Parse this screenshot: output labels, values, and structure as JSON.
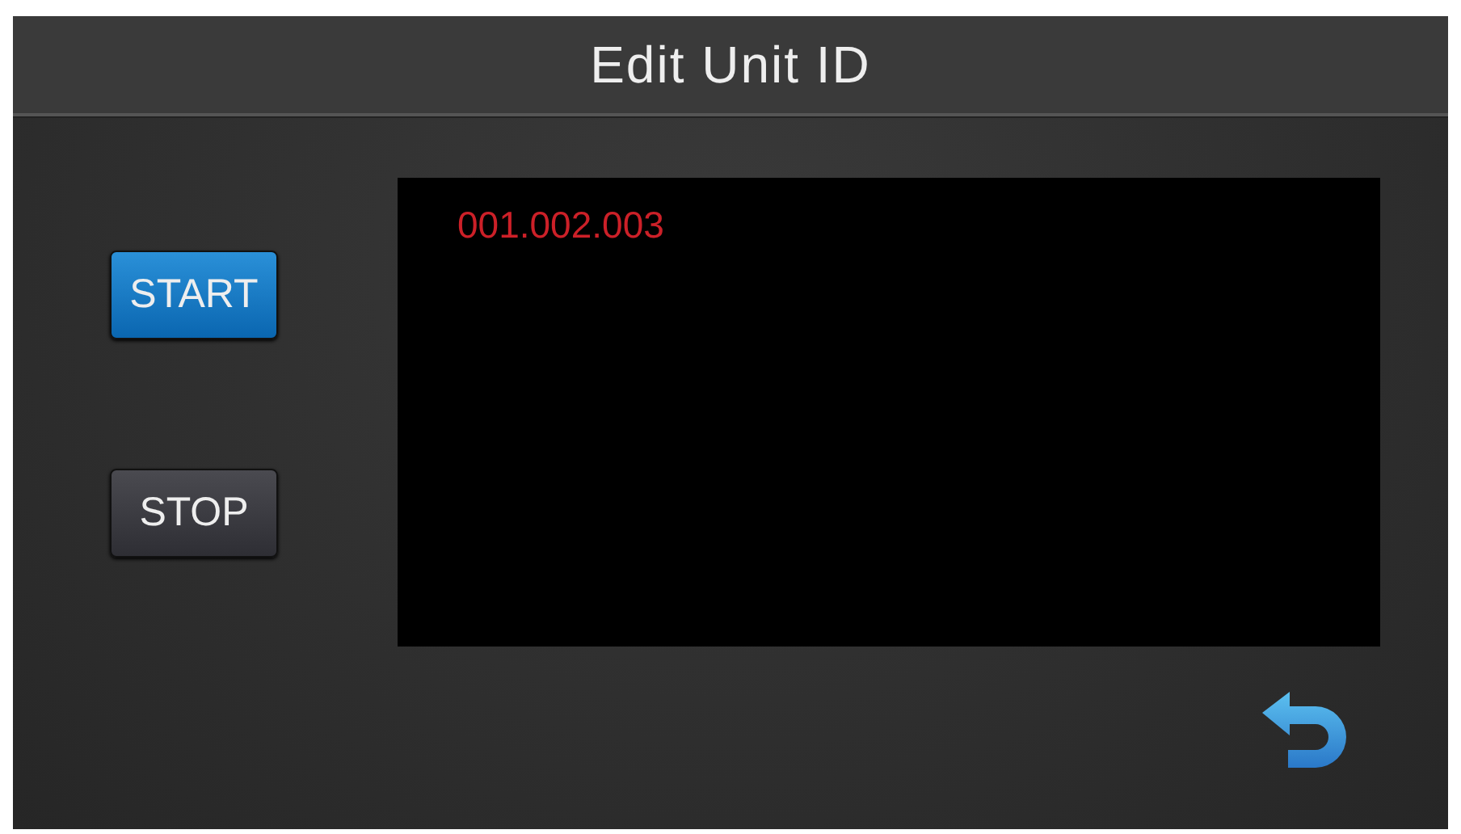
{
  "header": {
    "title": "Edit Unit ID"
  },
  "buttons": [
    {
      "label": "START",
      "selected": true
    },
    {
      "label": "STOP",
      "selected": false
    }
  ],
  "display": {
    "lines": [
      "001.002.003"
    ]
  }
}
